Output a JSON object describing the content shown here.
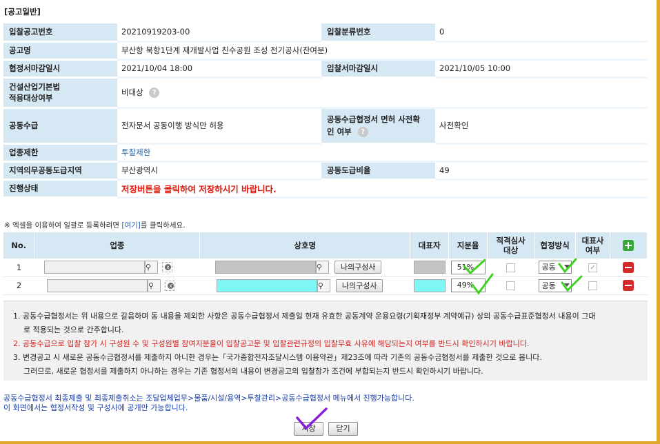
{
  "section_title": "[공고일반]",
  "info": {
    "bid_no_label": "입찰공고번호",
    "bid_no": "20210919203-00",
    "bid_class_label": "입찰분류번호",
    "bid_class": "0",
    "title_label": "공고명",
    "title": "부산항 북항1단계 재개발사업 친수공원 조성 전기공사(잔여분)",
    "agree_deadline_label": "협정서마감일시",
    "agree_deadline": "2021/10/04 18:00",
    "bid_deadline_label": "입찰서마감일시",
    "bid_deadline": "2021/10/05 10:00",
    "law_label_1": "건설산업기본법",
    "law_label_2": "적용대상여부",
    "law_value": "비대상",
    "joint_label": "공동수급",
    "joint_value": "전자문서 공동이행 방식만 허용",
    "exempt_label_1": "공동수급협정서 면허 사전확",
    "exempt_label_2": "인 여부",
    "exempt_value": "사전확인",
    "limit_label": "업종제한",
    "limit_value": "투찰제한",
    "region_label": "지역의무공동도급지역",
    "region_value": "부산광역시",
    "ratio_label": "공동도급비율",
    "ratio_value": "49",
    "status_label": "진행상태",
    "status_value": "저장버튼을 클릭하여 저장하시기 바랍니다."
  },
  "excel_note": {
    "prefix": "※ 엑셀을 이용하여 일괄로 등록하려면 ",
    "link": "[여기]",
    "suffix": "를 클릭하세요."
  },
  "grid": {
    "headers": {
      "no": "No.",
      "industry": "업종",
      "company": "상호명",
      "rep": "대표자",
      "share": "지분율",
      "qual_1": "적격심사",
      "qual_2": "대상",
      "method": "협정방식",
      "repr_1": "대표사",
      "repr_2": "여부"
    },
    "my_company_btn": "나의구성사",
    "rows": [
      {
        "no": "1",
        "share": "51",
        "method": "공동"
      },
      {
        "no": "2",
        "share": "49",
        "method": "공동"
      }
    ]
  },
  "notes": {
    "n1a": "1. 공동수급협정서는 위 내용으로 갈음하며 동 내용을 제외한 사항은 공동수급협정서 제출일 현재 유효한 공동계약 운용요령(기획재정부 계약예규) 상의 공동수급표준협정서 내용이 그대",
    "n1b": "로 적용되는 것으로 간주합니다.",
    "n2": "2. 공동수급으로 입찰 참가 시 구성원 수 및 구성원별 참여지분율이 입찰공고문 및 입찰관련규정의 입찰무효 사유에 해당되는지 여부를 반드시 확인하시기 바랍니다.",
    "n3a": "3. 변경공고 시 새로운 공동수급협정서를 제출하지 아니한 경우는「국가종합전자조달시스템 이용약관」제23조에 따라 기존의 공동수급협정서를 제출한 것으로 봅니다.",
    "n3b": "그러므로, 새로운 협정서를 제출하지 아니하는 경우는 기존 협정서의 내용이 변경공고의 입찰참가 조건에 부합되는지 반드시 확인하시기 바랍니다."
  },
  "footer": {
    "line1": "공동수급협정서 최종제출 및 최종제출취소는 조달업체업무>물품/시설/용역>투찰관리>공동수급협정서 메뉴에서 진행가능합니다.",
    "line2": "이 화면에서는 협정서작성 및 구성사에 공개만 가능합니다."
  },
  "buttons": {
    "save": "저장",
    "close": "닫기"
  },
  "colors": {
    "accent_frame": "#e2a72e",
    "label_bg": "#d7e8f5",
    "status_red": "#e0180e",
    "highlight_cyan": "#7ff6f6",
    "check_green": "#3fd11f",
    "check_purple": "#8a1fd6"
  },
  "icons": [
    "help-icon",
    "search-icon",
    "clear-icon",
    "plus-icon",
    "minus-icon",
    "checkmark-annotation"
  ]
}
